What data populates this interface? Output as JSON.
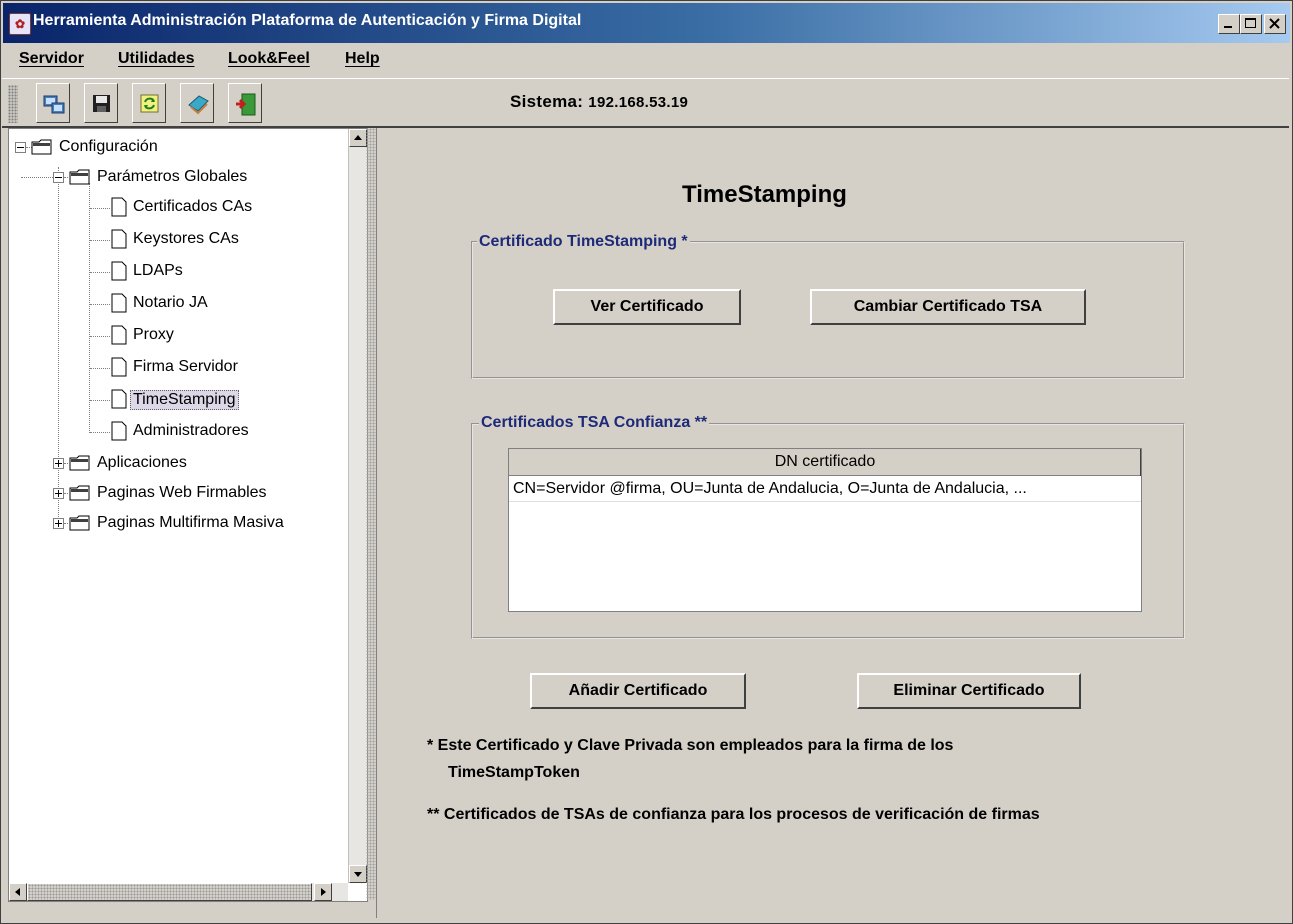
{
  "window": {
    "title": "Herramienta Administración Plataforma de Autenticación y Firma Digital",
    "app_icon": "app-seal-icon",
    "controls": [
      "minimize-icon",
      "maximize-icon",
      "close-icon"
    ]
  },
  "menubar": {
    "items": [
      {
        "label": "Servidor",
        "mnemonic": "S"
      },
      {
        "label": "Utilidades",
        "mnemonic": "U"
      },
      {
        "label": "Look&Feel",
        "mnemonic": "L"
      },
      {
        "label": "Help",
        "mnemonic": "H"
      }
    ]
  },
  "toolbar": {
    "buttons": [
      "connect-icon",
      "save-icon",
      "refresh-icon",
      "book-icon",
      "exit-icon"
    ],
    "system_label": "Sistema:",
    "system_value": "192.168.53.19"
  },
  "tree": {
    "root": "Configuración",
    "global_params": "Parámetros Globales",
    "leaves": [
      "Certificados CAs",
      "Keystores CAs",
      "LDAPs",
      "Notario JA",
      "Proxy",
      "Firma Servidor",
      "TimeStamping",
      "Administradores"
    ],
    "selected": "TimeStamping",
    "folders": [
      "Aplicaciones",
      "Paginas Web Firmables",
      "Paginas Multifirma Masiva"
    ]
  },
  "main": {
    "title": "TimeStamping",
    "cert_group": {
      "legend": "Certificado TimeStamping *",
      "view_button": "Ver Certificado",
      "change_button": "Cambiar Certificado TSA"
    },
    "trusted_group": {
      "legend": "Certificados TSA Confianza **",
      "column_header": "DN certificado",
      "rows": [
        "CN=Servidor @firma, OU=Junta de Andalucia, O=Junta de Andalucia, ..."
      ]
    },
    "add_button": "Añadir Certificado",
    "remove_button": "Eliminar Certificado",
    "note1_line1": "* Este Certificado y Clave Privada son empleados para la firma de los",
    "note1_line2": "TimeStampToken",
    "note2": "** Certificados de TSAs de confianza para los procesos de verificación de firmas"
  },
  "colors": {
    "titlebar_start": "#0a246a",
    "titlebar_end": "#a6caf0",
    "legend_text": "#1e2a78",
    "window_bg": "#d4d0c8",
    "selection_bg": "#dcd8e8"
  }
}
